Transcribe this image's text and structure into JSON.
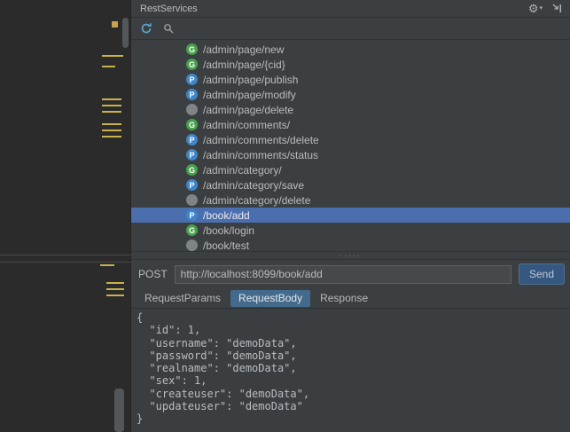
{
  "colors": {
    "get_method": "#47A14B",
    "post_method": "#3E86C7",
    "other_method": "#7F8487",
    "selection": "#4B6EAF",
    "tab_selected": "#436A8C",
    "send_button": "#365880",
    "marker_yellow": "#C9B14D",
    "icon_blue": "#62A7CE"
  },
  "header": {
    "title": "RestServices",
    "icons": [
      "gear-icon",
      "hide-icon"
    ]
  },
  "toolbar": {
    "icons": [
      "refresh-icon",
      "search-icon"
    ]
  },
  "endpoints": [
    {
      "method": "GET",
      "letter": "G",
      "path": "/admin/page/new",
      "selected": false
    },
    {
      "method": "GET",
      "letter": "G",
      "path": "/admin/page/{cid}",
      "selected": false
    },
    {
      "method": "POST",
      "letter": "P",
      "path": "/admin/page/publish",
      "selected": false
    },
    {
      "method": "POST",
      "letter": "P",
      "path": "/admin/page/modify",
      "selected": false
    },
    {
      "method": "OTHER",
      "letter": "",
      "path": "/admin/page/delete",
      "selected": false
    },
    {
      "method": "GET",
      "letter": "G",
      "path": "/admin/comments/",
      "selected": false
    },
    {
      "method": "POST",
      "letter": "P",
      "path": "/admin/comments/delete",
      "selected": false
    },
    {
      "method": "POST",
      "letter": "P",
      "path": "/admin/comments/status",
      "selected": false
    },
    {
      "method": "GET",
      "letter": "G",
      "path": "/admin/category/",
      "selected": false
    },
    {
      "method": "POST",
      "letter": "P",
      "path": "/admin/category/save",
      "selected": false
    },
    {
      "method": "OTHER",
      "letter": "",
      "path": "/admin/category/delete",
      "selected": false
    },
    {
      "method": "POST",
      "letter": "P",
      "path": "/book/add",
      "selected": true
    },
    {
      "method": "GET",
      "letter": "G",
      "path": "/book/login",
      "selected": false
    },
    {
      "method": "OTHER",
      "letter": "",
      "path": "/book/test",
      "selected": false
    }
  ],
  "request": {
    "method_label": "POST",
    "url": "http://localhost:8099/book/add",
    "send_label": "Send",
    "body_text": "{\n  \"id\": 1,\n  \"username\": \"demoData\",\n  \"password\": \"demoData\",\n  \"realname\": \"demoData\",\n  \"sex\": 1,\n  \"createuser\": \"demoData\",\n  \"updateuser\": \"demoData\"\n}"
  },
  "tabs": [
    {
      "label": "RequestParams",
      "selected": false
    },
    {
      "label": "RequestBody",
      "selected": true
    },
    {
      "label": "Response",
      "selected": false
    }
  ],
  "splitter_dots": "·····"
}
